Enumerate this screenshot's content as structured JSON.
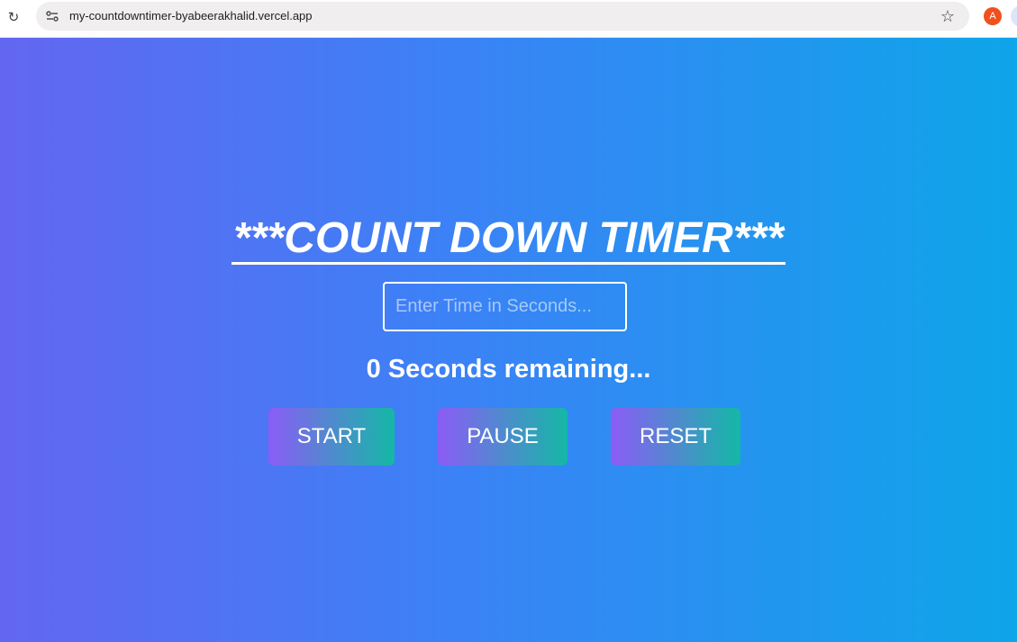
{
  "browser": {
    "url": "my-countdowntimer-byabeerakhalid.vercel.app",
    "profile_initial": "A",
    "icons": {
      "reload": "reload-icon",
      "site_info": "site-info-icon",
      "bookmark": "star-icon"
    }
  },
  "app": {
    "title": "***COUNT DOWN TIMER***",
    "input": {
      "placeholder": "Enter Time in Seconds...",
      "value": ""
    },
    "status": "0 Seconds remaining...",
    "buttons": {
      "start": "START",
      "pause": "PAUSE",
      "reset": "RESET"
    }
  },
  "colors": {
    "background_start": "#6366f1",
    "background_end": "#0ea5e9",
    "button_gradient_start": "#8b5cf6",
    "button_gradient_end": "#14b8a6",
    "profile_avatar": "#f0501e"
  }
}
